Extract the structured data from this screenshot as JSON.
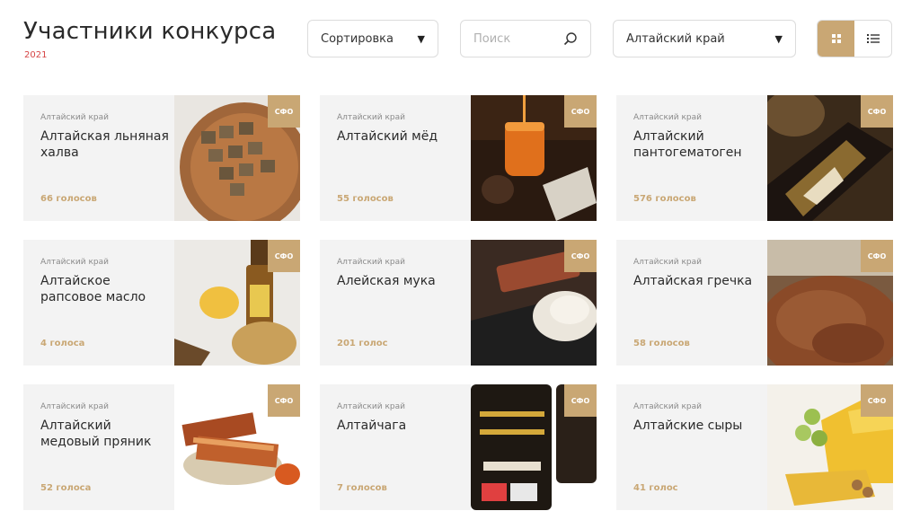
{
  "header": {
    "title": "Участники конкурса",
    "year": "2021",
    "sort_label": "Сортировка",
    "search_placeholder": "Поиск",
    "region_value": "Алтайский край"
  },
  "colors": {
    "accent": "#c9a774",
    "year": "#d64545",
    "card_bg": "#f3f3f3"
  },
  "cards": [
    {
      "region": "Алтайский край",
      "title": "Алтайская льняная халва",
      "votes": "66 голосов",
      "badge": "СФО",
      "image": "halva"
    },
    {
      "region": "Алтайский край",
      "title": "Алтайский мёд",
      "votes": "55 голосов",
      "badge": "СФО",
      "image": "honey"
    },
    {
      "region": "Алтайский край",
      "title": "Алтайский пантогематоген",
      "votes": "576 голосов",
      "badge": "СФО",
      "image": "bottle"
    },
    {
      "region": "Алтайский край",
      "title": "Алтайское рапсовое масло",
      "votes": "4 голоса",
      "badge": "СФО",
      "image": "oil"
    },
    {
      "region": "Алтайский край",
      "title": "Алейская мука",
      "votes": "201 голос",
      "badge": "СФО",
      "image": "flour"
    },
    {
      "region": "Алтайский край",
      "title": "Алтайская гречка",
      "votes": "58 голосов",
      "badge": "СФО",
      "image": "buckwheat"
    },
    {
      "region": "Алтайский край",
      "title": "Алтайский медовый пряник",
      "votes": "52 голоса",
      "badge": "СФО",
      "image": "gingerbread"
    },
    {
      "region": "Алтайский край",
      "title": "Алтайчага",
      "votes": "7 голосов",
      "badge": "СФО",
      "image": "chaga"
    },
    {
      "region": "Алтайский край",
      "title": "Алтайские сыры",
      "votes": "41 голос",
      "badge": "СФО",
      "image": "cheese"
    }
  ]
}
